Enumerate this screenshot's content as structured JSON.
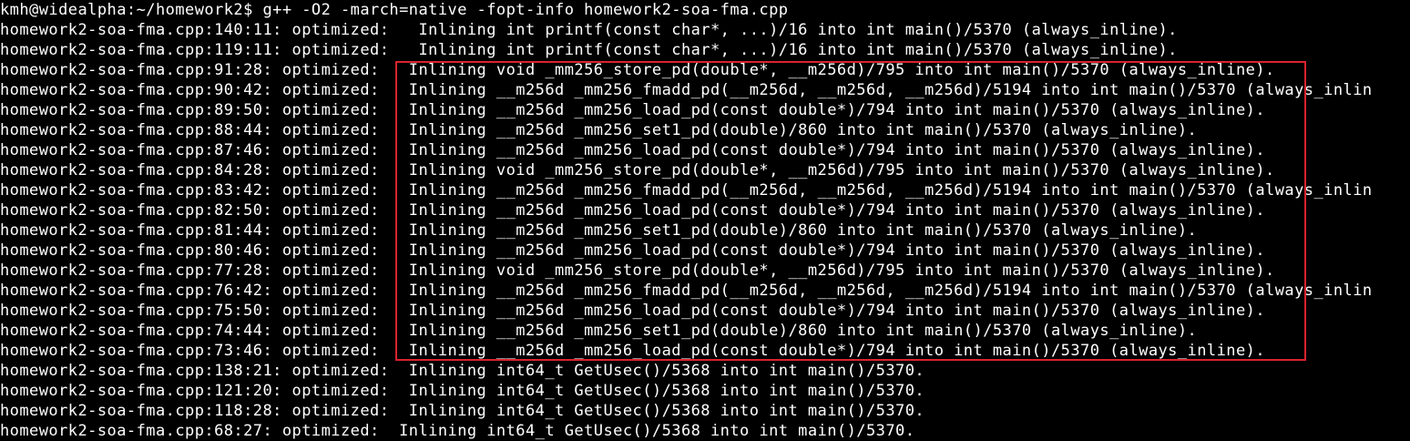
{
  "terminal": {
    "highlight_color": "#d9232e",
    "text_color": "#ffffff",
    "background_color": "#000000",
    "lines": [
      "kmh@widealpha:~/homework2$ g++ -O2 -march=native -fopt-info homework2-soa-fma.cpp",
      "homework2-soa-fma.cpp:140:11: optimized:   Inlining int printf(const char*, ...)/16 into int main()/5370 (always_inline).",
      "homework2-soa-fma.cpp:119:11: optimized:   Inlining int printf(const char*, ...)/16 into int main()/5370 (always_inline).",
      "homework2-soa-fma.cpp:91:28: optimized:   Inlining void _mm256_store_pd(double*, __m256d)/795 into int main()/5370 (always_inline).",
      "homework2-soa-fma.cpp:90:42: optimized:   Inlining __m256d _mm256_fmadd_pd(__m256d, __m256d, __m256d)/5194 into int main()/5370 (always_inlin",
      "homework2-soa-fma.cpp:89:50: optimized:   Inlining __m256d _mm256_load_pd(const double*)/794 into int main()/5370 (always_inline).",
      "homework2-soa-fma.cpp:88:44: optimized:   Inlining __m256d _mm256_set1_pd(double)/860 into int main()/5370 (always_inline).",
      "homework2-soa-fma.cpp:87:46: optimized:   Inlining __m256d _mm256_load_pd(const double*)/794 into int main()/5370 (always_inline).",
      "homework2-soa-fma.cpp:84:28: optimized:   Inlining void _mm256_store_pd(double*, __m256d)/795 into int main()/5370 (always_inline).",
      "homework2-soa-fma.cpp:83:42: optimized:   Inlining __m256d _mm256_fmadd_pd(__m256d, __m256d, __m256d)/5194 into int main()/5370 (always_inlin",
      "homework2-soa-fma.cpp:82:50: optimized:   Inlining __m256d _mm256_load_pd(const double*)/794 into int main()/5370 (always_inline).",
      "homework2-soa-fma.cpp:81:44: optimized:   Inlining __m256d _mm256_set1_pd(double)/860 into int main()/5370 (always_inline).",
      "homework2-soa-fma.cpp:80:46: optimized:   Inlining __m256d _mm256_load_pd(const double*)/794 into int main()/5370 (always_inline).",
      "homework2-soa-fma.cpp:77:28: optimized:   Inlining void _mm256_store_pd(double*, __m256d)/795 into int main()/5370 (always_inline).",
      "homework2-soa-fma.cpp:76:42: optimized:   Inlining __m256d _mm256_fmadd_pd(__m256d, __m256d, __m256d)/5194 into int main()/5370 (always_inlin",
      "homework2-soa-fma.cpp:75:50: optimized:   Inlining __m256d _mm256_load_pd(const double*)/794 into int main()/5370 (always_inline).",
      "homework2-soa-fma.cpp:74:44: optimized:   Inlining __m256d _mm256_set1_pd(double)/860 into int main()/5370 (always_inline).",
      "homework2-soa-fma.cpp:73:46: optimized:   Inlining __m256d _mm256_load_pd(const double*)/794 into int main()/5370 (always_inline).",
      "homework2-soa-fma.cpp:138:21: optimized:  Inlining int64_t GetUsec()/5368 into int main()/5370.",
      "homework2-soa-fma.cpp:121:20: optimized:  Inlining int64_t GetUsec()/5368 into int main()/5370.",
      "homework2-soa-fma.cpp:118:28: optimized:  Inlining int64_t GetUsec()/5368 into int main()/5370.",
      "homework2-soa-fma.cpp:68:27: optimized:  Inlining int64_t GetUsec()/5368 into int main()/5370."
    ]
  }
}
